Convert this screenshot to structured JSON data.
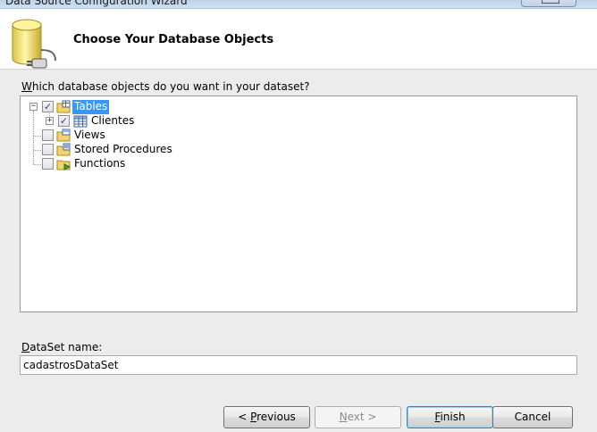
{
  "window": {
    "title": "Data Source Configuration Wizard"
  },
  "header": {
    "title": "Choose Your Database Objects",
    "icon": "database-plug-icon"
  },
  "question": {
    "label": "Which database objects do you want in your dataset?"
  },
  "tree": {
    "nodes": [
      {
        "label": "Tables",
        "checked": true,
        "expanded": true,
        "selected": true,
        "icon": "tables-folder-icon"
      },
      {
        "label": "Clientes",
        "checked": true,
        "expanded": false,
        "icon": "table-grid-icon"
      },
      {
        "label": "Views",
        "checked": false,
        "icon": "views-folder-icon"
      },
      {
        "label": "Stored Procedures",
        "checked": false,
        "icon": "stored-procedures-folder-icon"
      },
      {
        "label": "Functions",
        "checked": false,
        "icon": "functions-folder-icon"
      }
    ]
  },
  "dataset": {
    "label": "DataSet name:",
    "value": "cadastrosDataSet"
  },
  "buttons": {
    "previous": "< Previous",
    "next": "Next >",
    "finish": "Finish",
    "cancel": "Cancel"
  },
  "colors": {
    "selection": "#3399ff",
    "header_bg": "#ffffff",
    "dialog_bg": "#ececec"
  }
}
